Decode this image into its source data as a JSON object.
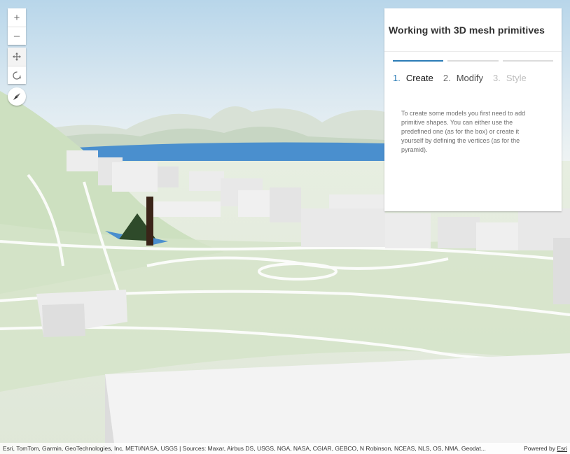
{
  "controls": {
    "zoom_in": "+",
    "zoom_out": "–",
    "pan_icon": "move-arrows-icon",
    "rotate_icon": "rotate-icon",
    "compass_icon": "compass-needle-icon"
  },
  "panel": {
    "title": "Working with 3D mesh primitives",
    "steps": [
      {
        "number": "1.",
        "label": "Create",
        "state": "active"
      },
      {
        "number": "2.",
        "label": "Modify",
        "state": "normal"
      },
      {
        "number": "3.",
        "label": "Style",
        "state": "disabled"
      }
    ],
    "description": "To create some models you first need to add primitive shapes. You can either use the predefined one (as for the box) or create it yourself by defining the vertices (as for the pyramid)."
  },
  "attribution": {
    "text": "Esri, TomTom, Garmin, GeoTechnologies, Inc, METI/NASA, USGS | Sources: Maxar, Airbus DS, USGS, NGA, NASA, CGIAR, GEBCO, N Robinson, NCEAS, NLS, OS, NMA, Geodat...",
    "powered_by": "Powered by",
    "powered_link": "Esri"
  },
  "colors": {
    "accent": "#2b7cb6",
    "water": "#4a8fce",
    "park": "#cfe0c1",
    "pyramid": "#2e4a2a",
    "box": "#3a2418"
  }
}
